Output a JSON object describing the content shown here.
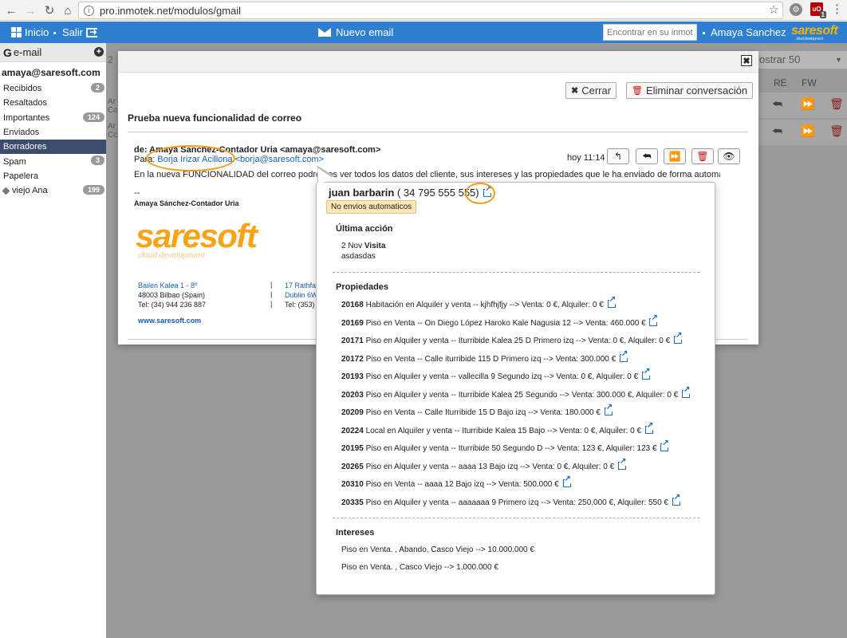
{
  "browser": {
    "url": "pro.inmotek.net/modulos/gmail",
    "ext_badge": "1"
  },
  "appbar": {
    "inicio": "Inicio",
    "salir": "Salir",
    "new_email": "Nuevo email",
    "search_placeholder": "Encontrar en su inmotek",
    "user": "Amaya Sanchez",
    "logo": "saresoft",
    "logo_sub": "cloud development"
  },
  "sidebar": {
    "title": "e-mail",
    "account": "amaya@saresoft.com",
    "items": [
      {
        "label": "Recibidos",
        "badge": "2"
      },
      {
        "label": "Resaltados",
        "badge": ""
      },
      {
        "label": "Importantes",
        "badge": "124"
      },
      {
        "label": "Enviados",
        "badge": ""
      },
      {
        "label": "Borradores",
        "badge": ""
      },
      {
        "label": "Spam",
        "badge": "3"
      },
      {
        "label": "Papelera",
        "badge": ""
      },
      {
        "label": "viejo Ana",
        "badge": "199"
      }
    ]
  },
  "background": {
    "mostrar": "ostrar 50",
    "re": "RE",
    "fw": "FW",
    "left_fragment_1": "2",
    "left_fragment_2": "Ar",
    "left_fragment_3": "Cc",
    "left_fragment_4": "Ar",
    "left_fragment_5": "Cc"
  },
  "modal": {
    "close_label": "Cerrar",
    "delete_label": "Eliminar conversación",
    "subject": "Prueba nueva funcionalidad de correo",
    "from": "de: Amaya Sanchez-Contador Uria <amaya@saresoft.com>",
    "to_prefix": "Para: ",
    "to_name": "Borja Irizar Acillona",
    "to_email": "<borja@saresoft.com>",
    "body": "En la nueva FUNCIONALIDAD del correo podremos ver todos los datos del cliente, sus intereses y las propiedades que le ha enviado de forma automática.",
    "time": "hoy 11:14",
    "sig_dash": "--",
    "sig_name": "Amaya Sánchez-Contador Uria",
    "logo": "saresoft",
    "logo_sub": "cloud development",
    "addr1_line1": "Bailen Kalea 1 - 8º",
    "addr1_line2": "48003 Bilbao (Spain)",
    "addr1_line3": "Tel: (34) 944 236 887",
    "addr2_line1": "17 Rathfar",
    "addr2_line2": "Dublin 6W",
    "addr2_line3": "Tel: (353) 8",
    "sep": "|",
    "web": "www.saresoft.com"
  },
  "popover": {
    "name": "juan barbarin",
    "phone": " ( 34 795 555 555)",
    "tag": "No envios automaticos",
    "last_action_title": "Última acción",
    "last_action_date": "2 Nov",
    "last_action_type": "Visita",
    "last_action_note": "asdasdas",
    "properties_title": "Propiedades",
    "properties": [
      {
        "id": "20168",
        "text": "Habitación en Alquiler y venta -- kjhfhjfjy --> Venta: 0 €, Alquiler: 0 €"
      },
      {
        "id": "20169",
        "text": "Piso en Venta -- On Diego López Haroko Kale Nagusia 12 --> Venta: 460.000 €"
      },
      {
        "id": "20171",
        "text": "Piso en Alquiler y venta -- Iturribide Kalea 25 D Primero izq --> Venta: 0 €, Alquiler: 0 €"
      },
      {
        "id": "20172",
        "text": "Piso en Venta -- Calle iturribide 115 D Primero izq --> Venta: 300.000 €"
      },
      {
        "id": "20193",
        "text": "Piso en Alquiler y venta -- vallecilla 9 Segundo izq --> Venta: 0 €, Alquiler: 0 €"
      },
      {
        "id": "20203",
        "text": "Piso en Alquiler y venta -- Iturribide Kalea 25 Segundo --> Venta: 300.000 €, Alquiler: 0 €"
      },
      {
        "id": "20209",
        "text": "Piso en Venta -- Calle Iturribide 15 D Bajo izq --> Venta: 180.000 €"
      },
      {
        "id": "20224",
        "text": "Local en Alquiler y venta -- Iturribide Kalea 15 Bajo --> Venta: 0 €, Alquiler: 0 €"
      },
      {
        "id": "20195",
        "text": "Piso en Alquiler y venta -- Iturribide 50 Segundo D --> Venta: 123 €, Alquiler: 123 €"
      },
      {
        "id": "20265",
        "text": "Piso en Alquiler y venta -- aaaa 13 Bajo izq --> Venta: 0 €, Alquiler: 0 €"
      },
      {
        "id": "20310",
        "text": "Piso en Venta -- aaaa 12 Bajo izq --> Venta: 500.000 €"
      },
      {
        "id": "20335",
        "text": "Piso en Alquiler y venta -- aaaaaaa 9 Primero izq --> Venta: 250.000 €, Alquiler: 550 €"
      }
    ],
    "interests_title": "Intereses",
    "interests": [
      "Piso en Venta. , Abando, Casco Viejo --> 10.000.000 €",
      "Piso en Venta. , Casco Viejo --> 1.000.000 €"
    ]
  },
  "colors": {
    "appbar": "#2f7fd0",
    "active_folder": "#3a4d6e",
    "accent_orange": "#f39c12",
    "logo_orange": "#f7a41a",
    "link_blue": "#1a5fb4"
  }
}
